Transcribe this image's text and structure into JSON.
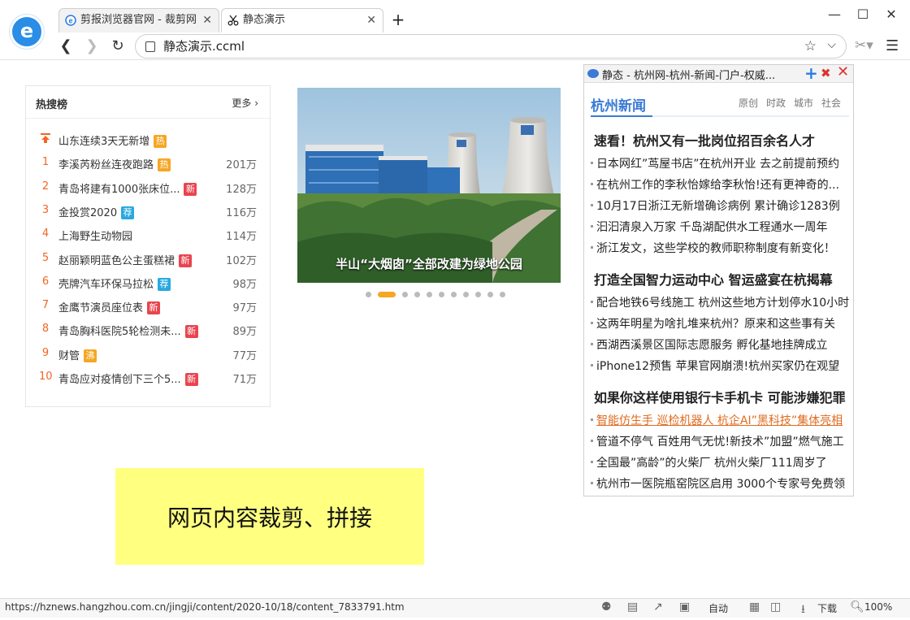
{
  "browser": {
    "tabs": [
      {
        "title": "剪报浏览器官网 - 裁剪网"
      },
      {
        "title": "静态演示"
      }
    ],
    "url": "静态演示.ccml",
    "status_url": "https://hznews.hangzhou.com.cn/jingji/content/2020-10/18/content_7833791.htm",
    "status_auto": "自动",
    "status_download": "下载",
    "status_zoom": "100%"
  },
  "hot": {
    "title": "热搜榜",
    "more": "更多",
    "items": [
      {
        "rank": "",
        "name": "山东连续3天无新增",
        "badge": "热",
        "count": ""
      },
      {
        "rank": "1",
        "name": "李溪芮粉丝连夜跑路",
        "badge": "热",
        "count": "201万"
      },
      {
        "rank": "2",
        "name": "青岛将建有1000张床位...",
        "badge": "新",
        "count": "128万"
      },
      {
        "rank": "3",
        "name": "金投赏2020",
        "badge": "荐",
        "count": "116万"
      },
      {
        "rank": "4",
        "name": "上海野生动物园",
        "badge": "",
        "count": "114万"
      },
      {
        "rank": "5",
        "name": "赵丽颖明蓝色公主蛋糕裙",
        "badge": "新",
        "count": "102万"
      },
      {
        "rank": "6",
        "name": "壳牌汽车环保马拉松",
        "badge": "荐",
        "count": "98万"
      },
      {
        "rank": "7",
        "name": "金鹰节演员座位表",
        "badge": "新",
        "count": "97万"
      },
      {
        "rank": "8",
        "name": "青岛胸科医院5轮检测未...",
        "badge": "新",
        "count": "89万"
      },
      {
        "rank": "9",
        "name": "财管",
        "badge": "沸",
        "count": "77万"
      },
      {
        "rank": "10",
        "name": "青岛应对疫情创下三个5...",
        "badge": "新",
        "count": "71万"
      }
    ]
  },
  "carousel": {
    "caption": "半山“大烟囱”全部改建为绿地公园"
  },
  "yellow_box": {
    "text": "网页内容裁剪、拼接"
  },
  "widget": {
    "title": "静态 - 杭州网-杭州-新闻-门户-权威...",
    "section_title": "杭州新闻",
    "tabs": [
      "原创",
      "时政",
      "城市",
      "社会"
    ],
    "groups": [
      {
        "headline": "速看！杭州又有一批岗位招百余名人才",
        "items": [
          "日本网红”茑屋书店”在杭州开业 去之前提前预约",
          "在杭州工作的李秋怡嫁给李秋怡!还有更神奇的...",
          "10月17日浙江无新增确诊病例 累计确诊1283例",
          "汩汩清泉入万家 千岛湖配供水工程通水一周年",
          "浙江发文，这些学校的教师职称制度有新变化！"
        ]
      },
      {
        "headline": "打造全国智力运动中心 智运盛宴在杭揭幕",
        "items": [
          "配合地铁6号线施工 杭州这些地方计划停水10小时",
          "这两年明星为啥扎堆来杭州？原来和这些事有关",
          "西湖西溪景区国际志愿服务 孵化基地挂牌成立",
          "iPhone12预售 苹果官网崩溃!杭州买家仍在观望"
        ]
      },
      {
        "headline": "如果你这样使用银行卡手机卡 可能涉嫌犯罪",
        "items": [
          "智能仿生手 巡检机器人 杭企AI”黑科技”集体亮相",
          "管道不停气 百姓用气无忧!新技术”加盟”燃气施工",
          "全国最”高龄”的火柴厂 杭州火柴厂111周岁了",
          "杭州市一医院瓶窑院区启用 3000个专家号免费领"
        ]
      }
    ]
  },
  "colors": {
    "accent_blue": "#3a7bd5",
    "rank_orange": "#f26522",
    "badge_hot": "#f5a623",
    "badge_new": "#e8454f",
    "badge_rec": "#29a8e0",
    "yellow": "#ffff80",
    "link_orange": "#e06b1f"
  }
}
